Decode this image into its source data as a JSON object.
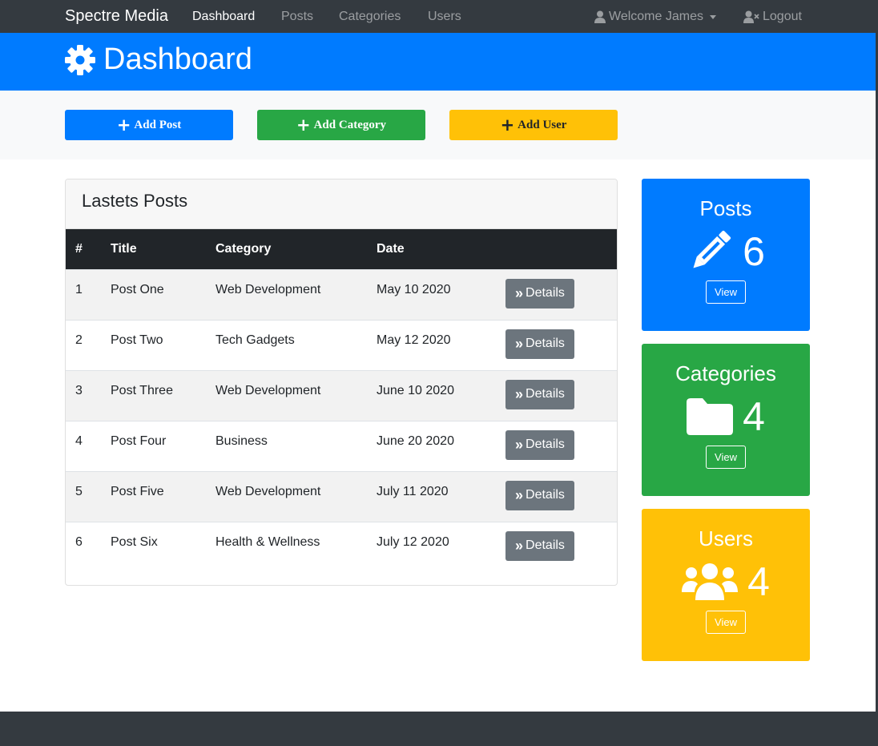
{
  "navbar": {
    "brand": "Spectre Media",
    "links": [
      "Dashboard",
      "Posts",
      "Categories",
      "Users"
    ],
    "welcome": "Welcome James",
    "logout": "Logout"
  },
  "header": {
    "title": "Dashboard"
  },
  "actions": {
    "add_post": "Add Post",
    "add_category": "Add Category",
    "add_user": "Add User"
  },
  "posts_card": {
    "title": "Lastets Posts",
    "columns": [
      "#",
      "Title",
      "Category",
      "Date"
    ],
    "details_label": "Details",
    "rows": [
      {
        "num": "1",
        "title": "Post One",
        "category": "Web Development",
        "date": "May 10 2020"
      },
      {
        "num": "2",
        "title": "Post Two",
        "category": "Tech Gadgets",
        "date": "May 12 2020"
      },
      {
        "num": "3",
        "title": "Post Three",
        "category": "Web Development",
        "date": "June 10 2020"
      },
      {
        "num": "4",
        "title": "Post Four",
        "category": "Business",
        "date": "June 20 2020"
      },
      {
        "num": "5",
        "title": "Post Five",
        "category": "Web Development",
        "date": "July 11 2020"
      },
      {
        "num": "6",
        "title": "Post Six",
        "category": "Health & Wellness",
        "date": "July 12 2020"
      }
    ]
  },
  "stats": {
    "posts": {
      "title": "Posts",
      "count": "6",
      "view": "View",
      "icon": "pencil-icon"
    },
    "categories": {
      "title": "Categories",
      "count": "4",
      "view": "View",
      "icon": "folder-icon"
    },
    "users": {
      "title": "Users",
      "count": "4",
      "view": "View",
      "icon": "users-icon"
    }
  },
  "colors": {
    "primary": "#007bff",
    "success": "#28a745",
    "warning": "#ffc107",
    "dark": "#343a40",
    "secondary": "#6c757d"
  }
}
